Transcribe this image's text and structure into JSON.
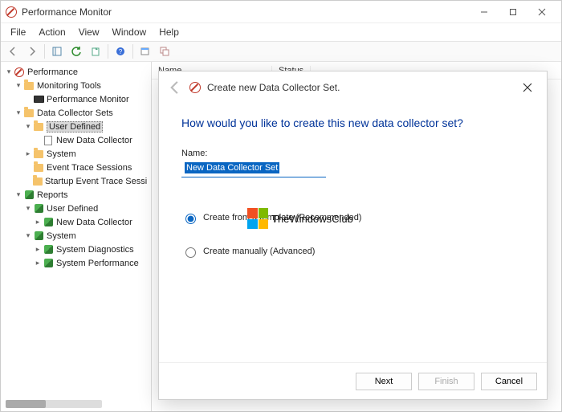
{
  "window": {
    "title": "Performance Monitor"
  },
  "menu": {
    "file": "File",
    "action": "Action",
    "view": "View",
    "window": "Window",
    "help": "Help"
  },
  "tree": {
    "root": "Performance",
    "monitoring": "Monitoring Tools",
    "perfmon": "Performance Monitor",
    "dcs": "Data Collector Sets",
    "userdef": "User Defined",
    "newdc": "New Data Collector",
    "system": "System",
    "ets": "Event Trace Sessions",
    "sets": "Startup Event Trace Sessi",
    "reports": "Reports",
    "rep_userdef": "User Defined",
    "rep_newdc": "New Data Collector",
    "rep_system": "System",
    "rep_sysdiag": "System Diagnostics",
    "rep_sysperf": "System Performance"
  },
  "columns": {
    "name": "Name",
    "status": "Status"
  },
  "dialog": {
    "breadcrumb": "Create new Data Collector Set.",
    "heading": "How would you like to create this new data collector set?",
    "name_label": "Name:",
    "name_value": "New Data Collector Set",
    "opt_template": "Create from a template (Recommended)",
    "opt_manual": "Create manually (Advanced)",
    "next": "Next",
    "finish": "Finish",
    "cancel": "Cancel"
  },
  "watermark": "TheWindowsClub"
}
